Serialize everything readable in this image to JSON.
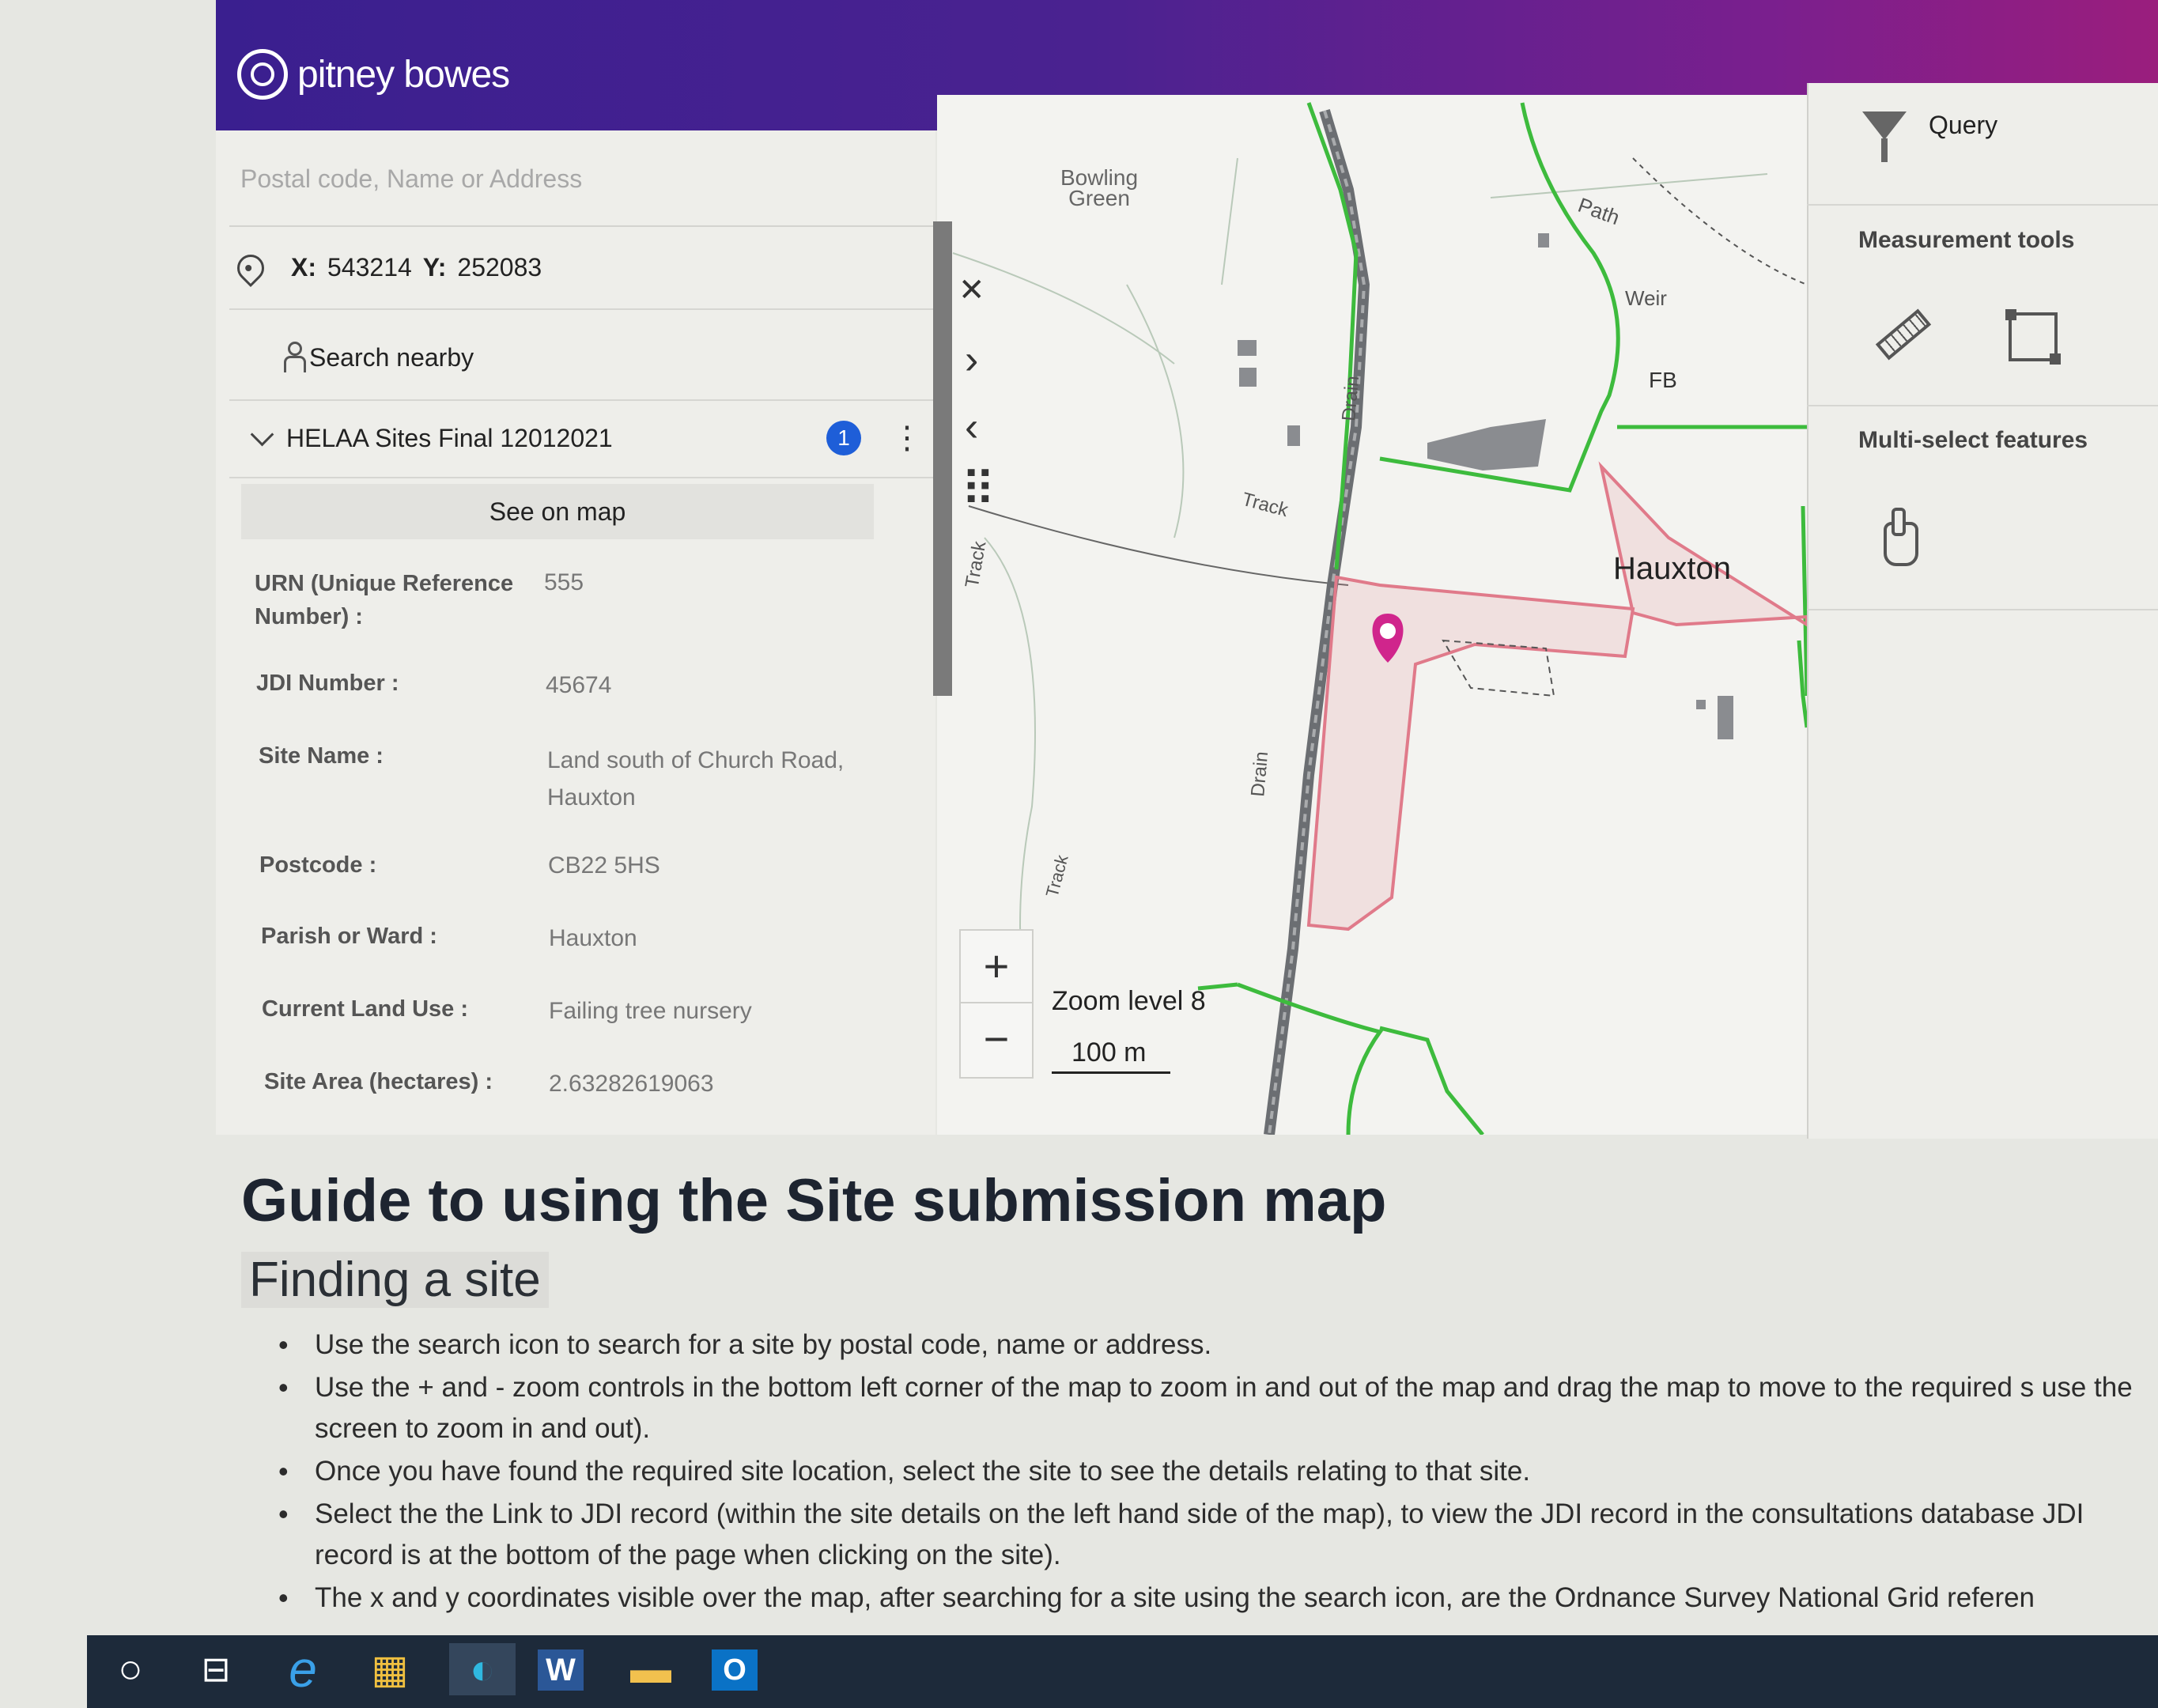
{
  "header": {
    "brand": "pitney bowes"
  },
  "left_panel": {
    "search_placeholder": "Postal code, Name or Address",
    "coords": {
      "x_label": "X:",
      "x_value": "543214",
      "y_label": "Y:",
      "y_value": "252083"
    },
    "search_nearby": "Search nearby",
    "layer": {
      "name": "HELAA Sites Final 12012021",
      "badge_count": "1",
      "menu_glyph": "⋮"
    },
    "see_on_map": "See on map",
    "fields": [
      {
        "label": "URN (Unique Reference Number) :",
        "value": "555"
      },
      {
        "label": "JDI Number :",
        "value": "45674"
      },
      {
        "label": "Site Name :",
        "value": "Land south of Church Road, Hauxton"
      },
      {
        "label": "Postcode :",
        "value": "CB22 5HS"
      },
      {
        "label": "Parish or Ward :",
        "value": "Hauxton"
      },
      {
        "label": "Current Land Use :",
        "value": "Failing tree nursery"
      },
      {
        "label": "Site Area (hectares) :",
        "value": "2.63282619063"
      }
    ]
  },
  "map": {
    "controls": {
      "close": "✕",
      "next": "›",
      "prev": "‹",
      "drag": "⠿"
    },
    "zoom_in": "+",
    "zoom_out": "−",
    "zoom_level": "Zoom level 8",
    "scale": "100 m",
    "labels": {
      "bowling_green": "Bowling Green",
      "path": "Path",
      "weir": "Weir",
      "fb": "FB",
      "drain_top": "Drain",
      "track_mid": "Track",
      "track_left": "Track",
      "hauxton": "Hauxton",
      "drain_mid": "Drain",
      "track_low": "Track"
    },
    "colors": {
      "boundary": "#3dbb3d",
      "site": "#e07a8a",
      "pin": "#d0258c"
    }
  },
  "right_panel": {
    "query": "Query",
    "measurement_title": "Measurement tools",
    "multiselect_title": "Multi-select features",
    "icons": [
      "funnel-icon",
      "ruler-icon",
      "polygon-area-icon",
      "hand-pointer-icon"
    ]
  },
  "guide": {
    "title": "Guide to using the Site submission map",
    "subtitle": "Finding a site",
    "bullets": [
      "Use the search icon to search for a site by postal code, name or address.",
      "Use the + and - zoom controls in the bottom left corner of the map to zoom in and out of the map and drag the map to move to the required s use the screen to zoom in and out).",
      "Once you have found the required site location, select the site to see the details relating to that site.",
      "Select the the Link to JDI record (within the site details on the left hand side of the map), to view the JDI record in the consultations database JDI record is at the bottom of the page when clicking on the site).",
      "The x and y coordinates visible over the map, after searching for a site using the search icon, are the Ordnance Survey National Grid referen"
    ]
  },
  "taskbar": {
    "icons": [
      "search-circle-icon",
      "task-view-icon",
      "internet-explorer-icon",
      "store-icon",
      "edge-icon",
      "word-icon",
      "file-explorer-icon",
      "outlook-icon"
    ],
    "glyphs": {
      "search": "○",
      "taskview": "⊟",
      "ie": "e",
      "store": "▦",
      "edge": "◐",
      "word": "W",
      "explorer": "▬",
      "outlook": "O"
    }
  }
}
